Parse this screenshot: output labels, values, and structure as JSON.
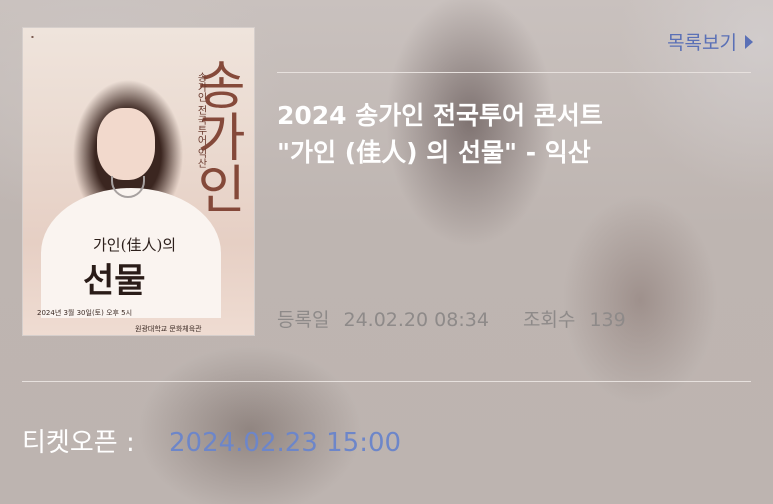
{
  "header": {
    "list_link_label": "목록보기"
  },
  "poster": {
    "big_name": "송가인",
    "side_caption": "송가인 전국투어 익산",
    "subtitle": "가인(佳人)의",
    "gift_text": "선물",
    "date_text": "2024년 3월 30일(토) 오후 5시",
    "venue_text": "원광대학교 문화체육관"
  },
  "post": {
    "title_line1": "2024 송가인 전국투어 콘서트",
    "title_line2": "\"가인 (佳人) 의 선물\" - 익산",
    "registered_label": "등록일",
    "registered_value": "24.02.20 08:34",
    "views_label": "조회수",
    "views_value": "139"
  },
  "ticket": {
    "label": "티켓오픈 :",
    "value": "2024.02.23 15:00"
  },
  "colors": {
    "link": "#5a70b6",
    "ticket_value": "#6d86c9",
    "meta_text": "#8e8a89",
    "title_text": "#ffffff"
  }
}
